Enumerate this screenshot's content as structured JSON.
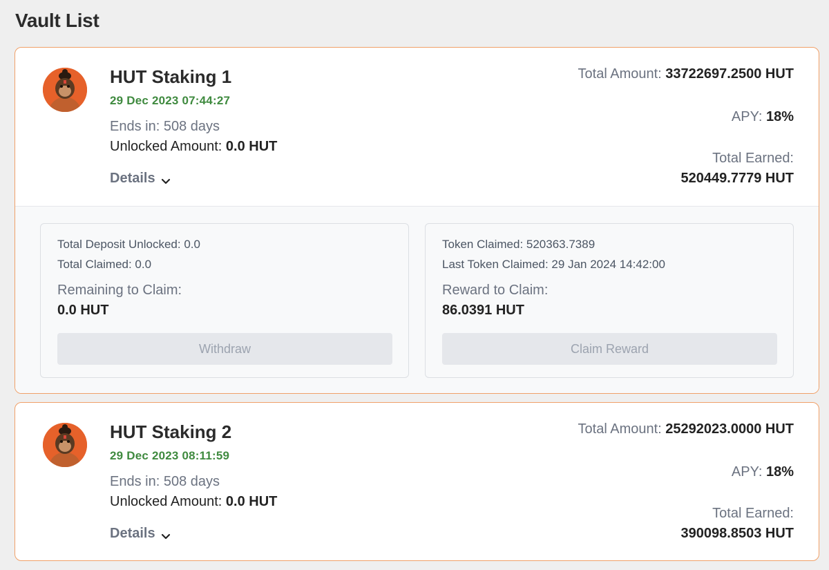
{
  "page": {
    "title": "Vault List"
  },
  "vaults": [
    {
      "name": "HUT Staking 1",
      "date": "29 Dec 2023 07:44:27",
      "ends_in": "Ends in: 508 days",
      "unlocked_label": "Unlocked Amount:",
      "unlocked_value": "0.0 HUT",
      "details_label": "Details",
      "total_amount_label": "Total Amount:",
      "total_amount_value": "33722697.2500 HUT",
      "apy_label": "APY:",
      "apy_value": "18%",
      "total_earned_label": "Total Earned:",
      "total_earned_value": "520449.7779 HUT",
      "expanded": true,
      "deposit_box": {
        "total_deposit_unlocked": "Total Deposit Unlocked: 0.0",
        "total_claimed": "Total Claimed: 0.0",
        "remaining_label": "Remaining to Claim:",
        "remaining_value": "0.0 HUT",
        "button_label": "Withdraw"
      },
      "reward_box": {
        "token_claimed": "Token Claimed: 520363.7389",
        "last_token_claimed": "Last Token Claimed: 29 Jan 2024 14:42:00",
        "reward_label": "Reward to Claim:",
        "reward_value": "86.0391 HUT",
        "button_label": "Claim Reward"
      }
    },
    {
      "name": "HUT Staking 2",
      "date": "29 Dec 2023 08:11:59",
      "ends_in": "Ends in: 508 days",
      "unlocked_label": "Unlocked Amount:",
      "unlocked_value": "0.0 HUT",
      "details_label": "Details",
      "total_amount_label": "Total Amount:",
      "total_amount_value": "25292023.0000 HUT",
      "apy_label": "APY:",
      "apy_value": "18%",
      "total_earned_label": "Total Earned:",
      "total_earned_value": "390098.8503 HUT",
      "expanded": false
    }
  ],
  "icons": {
    "avatar": "monkey-avatar-icon",
    "details_toggle": "chevron-down-icon"
  },
  "colors": {
    "accent_border": "#f0a068",
    "date_green": "#3f8a3f",
    "avatar_bg": "#e6612a"
  }
}
